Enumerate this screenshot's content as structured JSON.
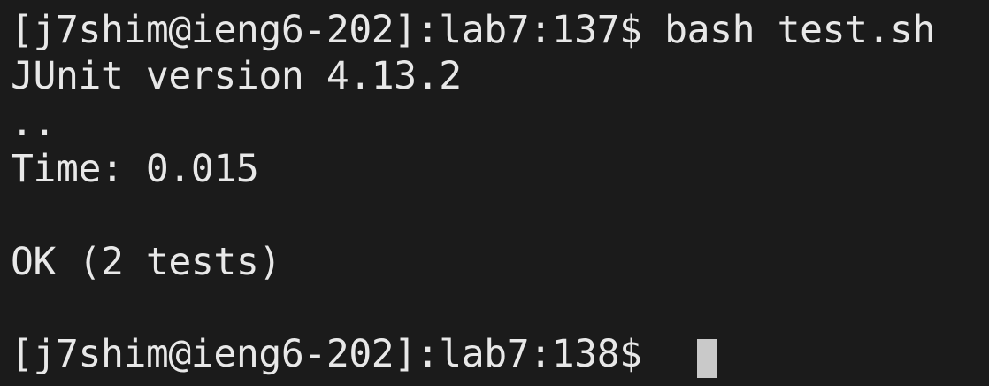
{
  "terminal": {
    "lines": [
      "[j7shim@ieng6-202]:lab7:137$ bash test.sh",
      "JUnit version 4.13.2",
      "..",
      "Time: 0.015",
      "OK (2 tests)",
      "[j7shim@ieng6-202]:lab7:138$ "
    ]
  }
}
